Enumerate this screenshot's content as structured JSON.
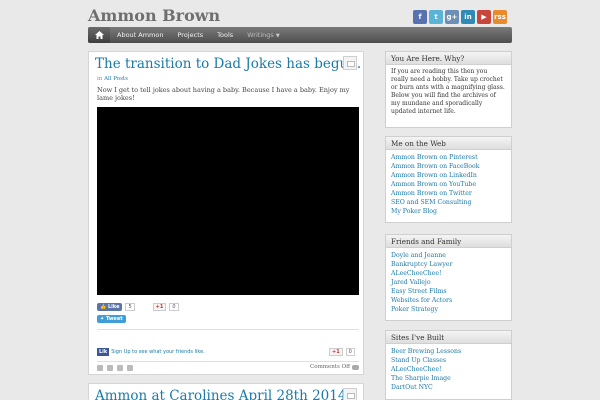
{
  "site": {
    "title": "Ammon Brown"
  },
  "social": [
    "f",
    "t",
    "g+",
    "in",
    "▶",
    "rss"
  ],
  "nav": {
    "items": [
      "About Ammon",
      "Projects",
      "Tools",
      "Writings"
    ]
  },
  "post1": {
    "title": "The transition to Dad Jokes has begun.",
    "meta_prefix": "in",
    "category": "All Posts",
    "text": "Now I get to tell jokes about having a baby. Because I have a baby. Enjoy my lame jokes!",
    "like_label": "Like",
    "like_count": "5",
    "gplus_label": "+1",
    "gplus_count": "0",
    "tweet_label": "Tweet",
    "fb_box": "Lik",
    "fb_text": "Sign Up to see what your friends like.",
    "gplus2_label": "+1",
    "gplus2_count": "0",
    "comments": "Comments Off"
  },
  "post2": {
    "title": "Ammon at Carolines April 28th 2014"
  },
  "sidebar": {
    "why": {
      "title": "You Are Here. Why?",
      "text": "If you are reading this then you really need a hobby. Take up crochet or burn ants with a magnifying glass. Below you will find the archives of my mundane and sporadically updated internet life."
    },
    "web": {
      "title": "Me on the Web",
      "links": [
        "Ammon Brown on Pinterest",
        "Ammon Brown on FaceBook",
        "Ammon Brown on LinkedIn",
        "Ammon Brown on YouTube",
        "Ammon Brown on Twitter",
        "SEO and SEM Consulting",
        "My Poker Blog"
      ]
    },
    "friends": {
      "title": "Friends and Family",
      "links": [
        "Doyle and Jeanne",
        "Bankruptcy Lawyer",
        "ALeeCheeChee!",
        "Jared Vallejo",
        "Easy Street Films",
        "Websites for Actors",
        "Poker Strategy"
      ]
    },
    "built": {
      "title": "Sites I've Built",
      "links": [
        "Beer Brewing Lessons",
        "Stand Up Classes",
        "ALeeCheeChee!",
        "The Sharpie Image",
        "DartOut NYC"
      ]
    }
  }
}
